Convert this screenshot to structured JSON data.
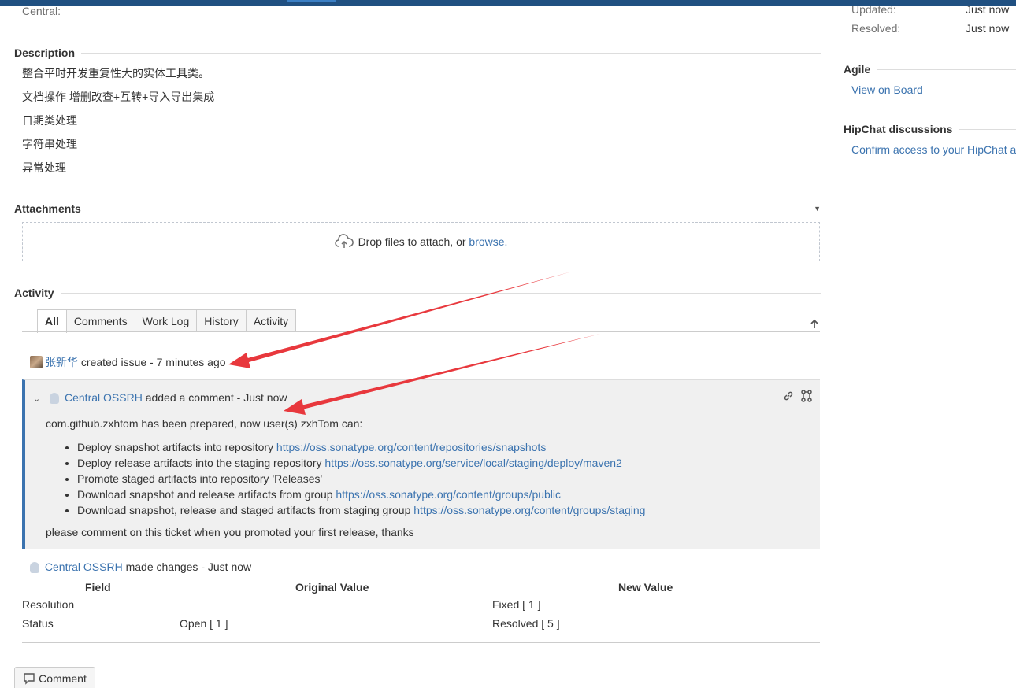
{
  "central_label": "Central:",
  "description": {
    "heading": "Description",
    "lines": [
      "整合平时开发重复性大的实体工具类。",
      "文档操作 增删改查+互转+导入导出集成",
      "日期类处理",
      "字符串处理",
      "异常处理"
    ]
  },
  "attachments": {
    "heading": "Attachments",
    "drop_text": "Drop files to attach, or",
    "browse_link": "browse."
  },
  "activity": {
    "heading": "Activity",
    "tabs": [
      {
        "label": "All",
        "active": true
      },
      {
        "label": "Comments",
        "active": false
      },
      {
        "label": "Work Log",
        "active": false
      },
      {
        "label": "History",
        "active": false
      },
      {
        "label": "Activity",
        "active": false
      }
    ],
    "created": {
      "user": "张新华",
      "text": "created issue - 7 minutes ago"
    },
    "comment": {
      "user": "Central OSSRH",
      "text": "added a comment - Just now",
      "intro": "com.github.zxhtom has been prepared, now user(s) zxhTom can:",
      "items": [
        {
          "text": "Deploy snapshot artifacts into repository",
          "link": "https://oss.sonatype.org/content/repositories/snapshots"
        },
        {
          "text": "Deploy release artifacts into the staging repository",
          "link": "https://oss.sonatype.org/service/local/staging/deploy/maven2"
        },
        {
          "text": "Promote staged artifacts into repository 'Releases'",
          "link": ""
        },
        {
          "text": "Download snapshot and release artifacts from group",
          "link": "https://oss.sonatype.org/content/groups/public"
        },
        {
          "text": "Download snapshot, release and staged artifacts from staging group",
          "link": "https://oss.sonatype.org/content/groups/staging"
        }
      ],
      "closing": "please comment on this ticket when you promoted your first release, thanks"
    },
    "changes": {
      "user": "Central OSSRH",
      "text": "made changes - Just now",
      "headers": [
        "Field",
        "Original Value",
        "New Value"
      ],
      "rows": [
        {
          "field": "Resolution",
          "original": "",
          "new": "Fixed [ 1 ]"
        },
        {
          "field": "Status",
          "original": "Open [ 1 ]",
          "new": "Resolved [ 5 ]"
        }
      ]
    }
  },
  "comment_button": "Comment",
  "sidebar": {
    "updated_label": "Updated:",
    "updated_value": "Just now",
    "resolved_label": "Resolved:",
    "resolved_value": "Just now",
    "agile_heading": "Agile",
    "agile_link": "View on Board",
    "hipchat_heading": "HipChat discussions",
    "hipchat_link": "Confirm access to your HipChat a"
  },
  "colors": {
    "link": "#3b73af",
    "annotation_arrow": "#e8383d",
    "header_bar": "#205081"
  }
}
